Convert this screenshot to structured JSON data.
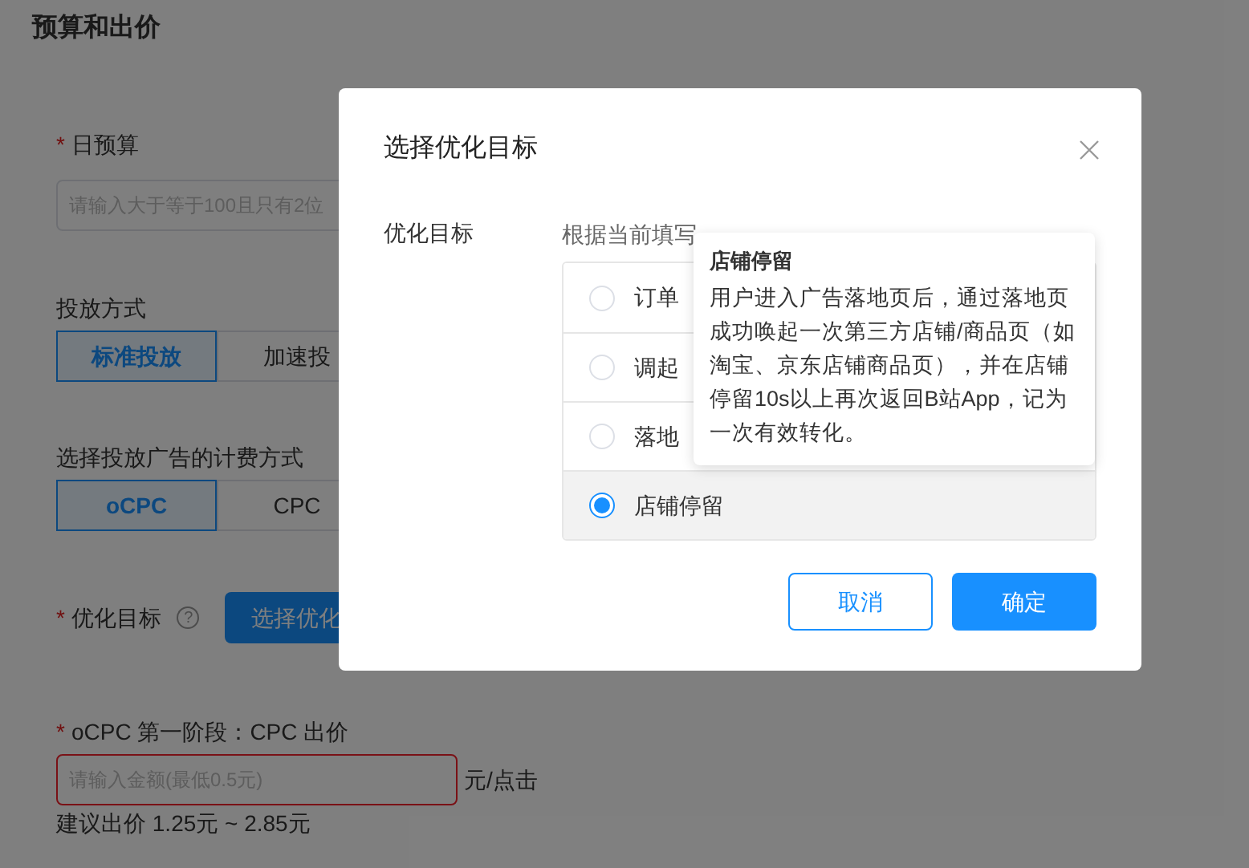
{
  "page": {
    "title": "预算和出价",
    "budget": {
      "label": "日预算",
      "required": true,
      "required_mark": "*",
      "placeholder": "请输入大于等于100且只有2位"
    },
    "delivery": {
      "label": "投放方式",
      "options": [
        {
          "label": "标准投放",
          "selected": true
        },
        {
          "label": "加速投",
          "selected": false
        }
      ]
    },
    "billing": {
      "label": "选择投放广告的计费方式",
      "options": [
        {
          "label": "oCPC",
          "selected": true
        },
        {
          "label": "CPC",
          "selected": false
        }
      ]
    },
    "goal": {
      "label": "优化目标",
      "required": true,
      "required_mark": "*",
      "help": "?",
      "button": "选择优化"
    },
    "bid": {
      "label": "oCPC 第一阶段：CPC 出价",
      "required": true,
      "required_mark": "*",
      "placeholder": "请输入金额(最低0.5元)",
      "unit": "元/点击",
      "error": true,
      "suggestion": "建议出价 1.25元 ~ 2.85元"
    }
  },
  "dialog": {
    "title": "选择优化目标",
    "label": "优化目标",
    "hint": "根据当前填写",
    "options": [
      {
        "label": "订单",
        "selected": false
      },
      {
        "label": "调起",
        "selected": false
      },
      {
        "label": "落地",
        "selected": false
      },
      {
        "label": "店铺停留",
        "selected": true
      }
    ],
    "tooltip": {
      "title": "店铺停留",
      "body": "用户进入广告落地页后，通过落地页成功唤起一次第三方店铺/商品页（如淘宝、京东店铺商品页），并在店铺停留10s以上再次返回B站App，记为一次有效转化。"
    },
    "buttons": [
      {
        "label": "取消",
        "kind": "secondary"
      },
      {
        "label": "确定",
        "kind": "primary"
      }
    ]
  }
}
